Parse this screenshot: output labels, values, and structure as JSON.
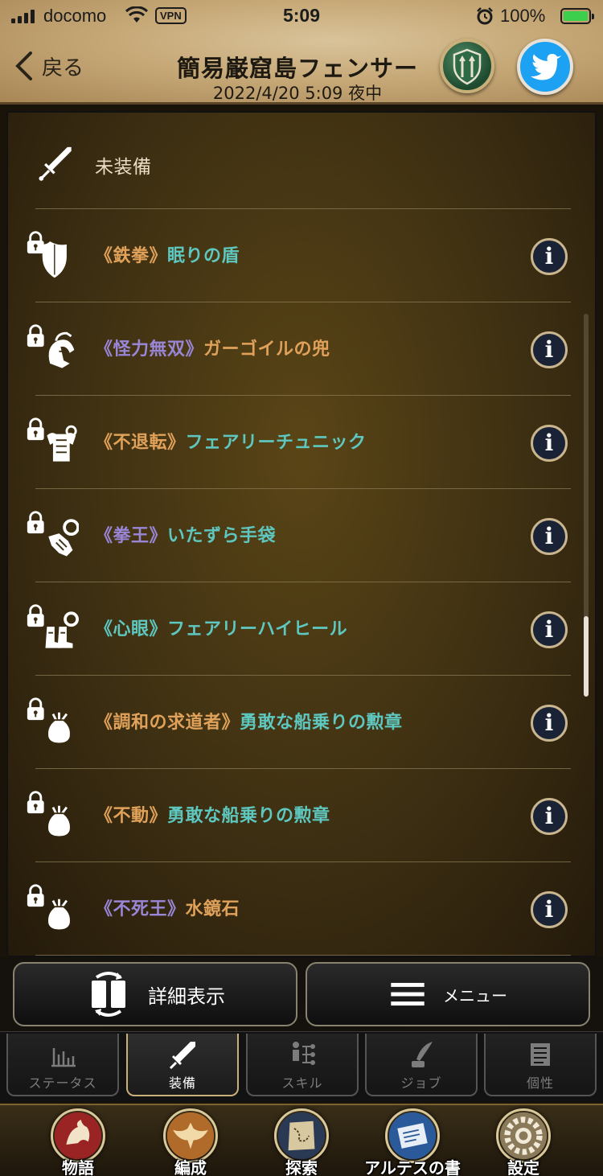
{
  "status_bar": {
    "carrier": "docomo",
    "vpn": "VPN",
    "time": "5:09",
    "battery": "100%"
  },
  "header": {
    "back_label": "戻る",
    "title": "簡易巌窟島フェンサー",
    "subtitle": "2022/4/20  5:09  夜中"
  },
  "equipment": {
    "weapon": {
      "label": "未装備",
      "icon": "sword-icon"
    },
    "items": [
      {
        "prefix": "《鉄拳》",
        "name": "眠りの盾",
        "prefix_color": "#e0a15a",
        "name_color": "#5ec8c0",
        "icon": "shield-icon"
      },
      {
        "prefix": "《怪力無双》",
        "name": "ガーゴイルの兜",
        "prefix_color": "#9a86d6",
        "name_color": "#e0a15a",
        "icon": "helmet-icon"
      },
      {
        "prefix": "《不退転》",
        "name": "フェアリーチュニック",
        "prefix_color": "#e0a15a",
        "name_color": "#5ec8c0",
        "icon": "armor-icon"
      },
      {
        "prefix": "《拳王》",
        "name": "いたずら手袋",
        "prefix_color": "#9a86d6",
        "name_color": "#5ec8c0",
        "icon": "gauntlet-icon"
      },
      {
        "prefix": "《心眼》",
        "name": "フェアリーハイヒール",
        "prefix_color": "#5ec8c0",
        "name_color": "#5ec8c0",
        "icon": "boots-icon"
      },
      {
        "prefix": "《調和の求道者》",
        "name": "勇敢な船乗りの勲章",
        "prefix_color": "#e0a15a",
        "name_color": "#5ec8c0",
        "icon": "accessory-bag-icon"
      },
      {
        "prefix": "《不動》",
        "name": "勇敢な船乗りの勲章",
        "prefix_color": "#e0a15a",
        "name_color": "#5ec8c0",
        "icon": "accessory-bag-icon"
      },
      {
        "prefix": "《不死王》",
        "name": "水鏡石",
        "prefix_color": "#9a86d6",
        "name_color": "#e0a15a",
        "icon": "accessory-bag-icon"
      }
    ]
  },
  "actions": {
    "detail_label": "詳細表示",
    "menu_label": "メニュー"
  },
  "tabs": [
    {
      "label": "ステータス",
      "icon": "bar-chart-icon",
      "active": false
    },
    {
      "label": "装備",
      "icon": "sword-icon",
      "active": true
    },
    {
      "label": "スキル",
      "icon": "skill-tree-icon",
      "active": false
    },
    {
      "label": "ジョブ",
      "icon": "quill-icon",
      "active": false
    },
    {
      "label": "個性",
      "icon": "scroll-icon",
      "active": false
    }
  ],
  "nav": [
    {
      "label": "物語",
      "icon": "dragon-icon"
    },
    {
      "label": "編成",
      "icon": "eagle-crest-icon"
    },
    {
      "label": "探索",
      "icon": "map-icon"
    },
    {
      "label": "アルテスの書",
      "icon": "letter-icon"
    },
    {
      "label": "設定",
      "icon": "gear-icon"
    }
  ]
}
